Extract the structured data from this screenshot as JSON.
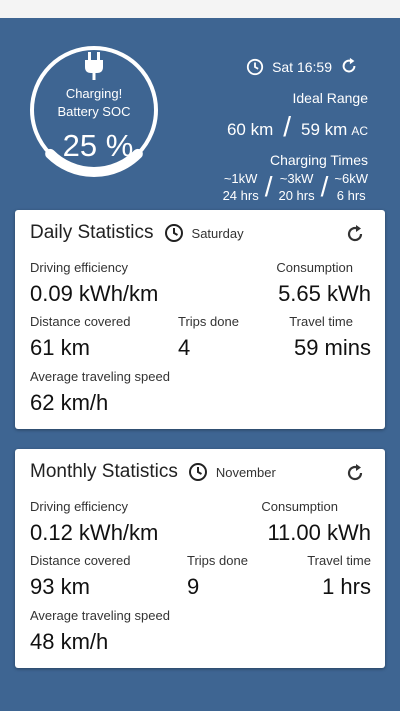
{
  "header": {
    "charging_status": "Charging!",
    "battery_label": "Battery SOC",
    "battery_value": "25 %",
    "battery_fraction": 0.25,
    "time": "Sat 16:59",
    "ideal_range_title": "Ideal Range",
    "range_primary": "60 km",
    "range_separator": "/",
    "range_secondary": "59 km",
    "range_secondary_unit": "AC",
    "charging_times_title": "Charging Times",
    "charging_times": [
      {
        "power": "~1kW",
        "duration": "24 hrs"
      },
      {
        "power": "~3kW",
        "duration": "20 hrs"
      },
      {
        "power": "~6kW",
        "duration": "6 hrs"
      }
    ],
    "separator": "/"
  },
  "daily": {
    "title": "Daily Statistics",
    "period": "Saturday",
    "driving_efficiency_label": "Driving efficiency",
    "driving_efficiency_value": "0.09 kWh/km",
    "consumption_label": "Consumption",
    "consumption_value": "5.65 kWh",
    "distance_label": "Distance covered",
    "distance_value": "61 km",
    "trips_label": "Trips done",
    "trips_value": "4",
    "travel_time_label": "Travel time",
    "travel_time_value": "59 mins",
    "avg_speed_label": "Average traveling speed",
    "avg_speed_value": "62 km/h"
  },
  "monthly": {
    "title": "Monthly Statistics",
    "period": "November",
    "driving_efficiency_label": "Driving efficiency",
    "driving_efficiency_value": "0.12 kWh/km",
    "consumption_label": "Consumption",
    "consumption_value": "11.00 kWh",
    "distance_label": "Distance covered",
    "distance_value": "93 km",
    "trips_label": "Trips done",
    "trips_value": "9",
    "travel_time_label": "Travel time",
    "travel_time_value": "1 hrs",
    "avg_speed_label": "Average traveling speed",
    "avg_speed_value": "48 km/h"
  },
  "colors": {
    "background": "#3e6592",
    "card": "#ffffff",
    "gauge_track": "#ffffff"
  },
  "icons": {
    "plug": "plug-icon",
    "clock": "clock-icon",
    "refresh": "refresh-icon"
  }
}
